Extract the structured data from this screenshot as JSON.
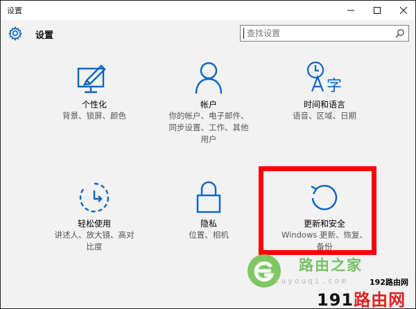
{
  "window": {
    "title": "设置"
  },
  "header": {
    "title": "设置",
    "search_placeholder": "查找设置"
  },
  "tiles": [
    {
      "name": "个性化",
      "desc": "背景、锁屏、颜色",
      "icon": "personalization-icon"
    },
    {
      "name": "帐户",
      "desc": "你的帐户、电子邮件、同步设置、工作、其他用户",
      "icon": "account-icon"
    },
    {
      "name": "时间和语言",
      "desc": "语音、区域、日期",
      "icon": "time-language-icon"
    },
    {
      "name": "轻松使用",
      "desc": "讲述人、放大镜、高对比度",
      "icon": "ease-of-access-icon"
    },
    {
      "name": "隐私",
      "desc": "位置、相机",
      "icon": "lock-icon"
    },
    {
      "name": "更新和安全",
      "desc": "Windows 更新、恢复、备份",
      "icon": "update-icon"
    }
  ],
  "watermark": {
    "text": "路由之家",
    "url": "luyouqi.com",
    "brand_top": "192路由网",
    "brand_num": "191",
    "brand_word": "路由网"
  },
  "colors": {
    "accent": "#0a64c2",
    "highlight": "#ff0000"
  }
}
